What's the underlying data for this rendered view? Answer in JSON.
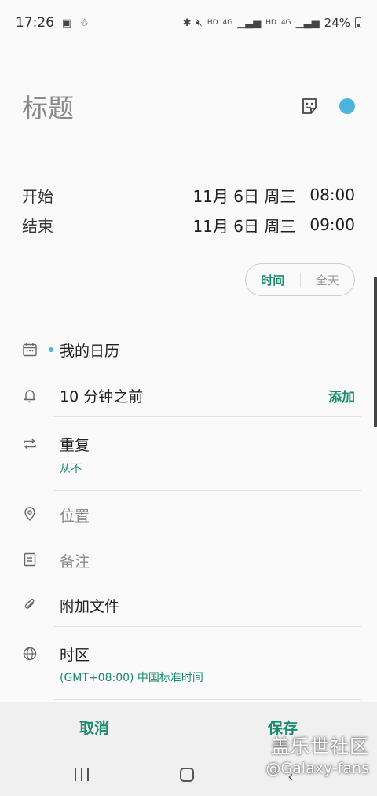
{
  "status_bar": {
    "time": "17:26",
    "battery": "24%",
    "signal_labels": [
      "HD",
      "4G",
      "HD",
      "4G"
    ],
    "left_icons": [
      "image-icon",
      "notification-icon"
    ],
    "right_icons": [
      "bluetooth-icon",
      "mute-icon",
      "signal-icon",
      "battery-icon"
    ]
  },
  "event": {
    "title_placeholder": "标题",
    "color": "#4bb3dd"
  },
  "time": {
    "start_label": "开始",
    "start_date": "11月 6日 周三",
    "start_time": "08:00",
    "end_label": "结束",
    "end_date": "11月 6日 周三",
    "end_time": "09:00",
    "toggle": {
      "option_time": "时间",
      "option_all_day": "全天",
      "selected": "时间"
    }
  },
  "fields": {
    "calendar": "我的日历",
    "reminder": "10 分钟之前",
    "reminder_action": "添加",
    "repeat": "重复",
    "repeat_value": "从不",
    "location_placeholder": "位置",
    "notes_placeholder": "备注",
    "attachment": "附加文件",
    "timezone": "时区",
    "timezone_value": "(GMT+08:00) 中国标准时间"
  },
  "actions": {
    "cancel": "取消",
    "save": "保存"
  },
  "watermark": {
    "line1": "盖乐世社区",
    "line2": "@Galaxy-fans"
  },
  "colors": {
    "accent": "#1c8a6c",
    "event_dot": "#4bb3dd"
  }
}
